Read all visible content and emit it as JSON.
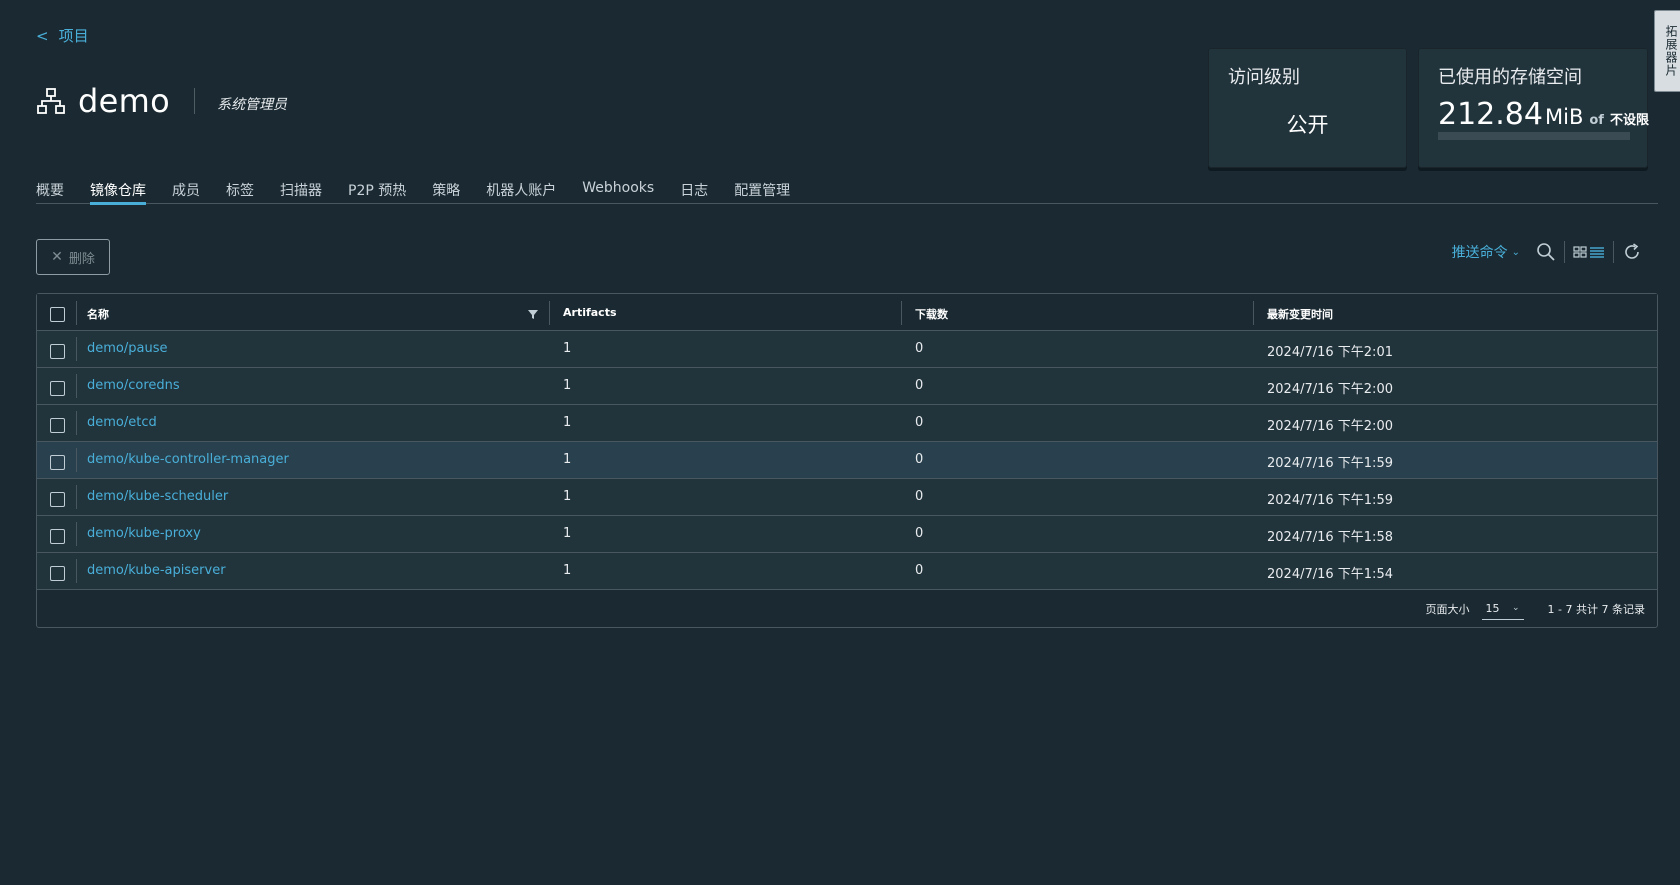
{
  "nav": {
    "back_label": "项目"
  },
  "project": {
    "name": "demo",
    "role": "系统管理员"
  },
  "cards": {
    "access": {
      "title": "访问级别",
      "value": "公开"
    },
    "storage": {
      "title": "已使用的存储空间",
      "used": "212.84",
      "unit": "MiB",
      "of": "of",
      "limit": "不设限",
      "usage_fraction": 0
    }
  },
  "side_tab": {
    "label": "拓展器片"
  },
  "tabs": [
    "概要",
    "镜像仓库",
    "成员",
    "标签",
    "扫描器",
    "P2P 预热",
    "策略",
    "机器人账户",
    "Webhooks",
    "日志",
    "配置管理"
  ],
  "active_tab": "镜像仓库",
  "toolbar": {
    "delete_label": "删除",
    "push_command_label": "推送命令"
  },
  "table": {
    "columns": [
      "名称",
      "Artifacts",
      "下载数",
      "最新变更时间"
    ],
    "rows": [
      {
        "name": "demo/pause",
        "artifacts": "1",
        "pulls": "0",
        "updated": "2024/7/16 下午2:01"
      },
      {
        "name": "demo/coredns",
        "artifacts": "1",
        "pulls": "0",
        "updated": "2024/7/16 下午2:00"
      },
      {
        "name": "demo/etcd",
        "artifacts": "1",
        "pulls": "0",
        "updated": "2024/7/16 下午2:00"
      },
      {
        "name": "demo/kube-controller-manager",
        "artifacts": "1",
        "pulls": "0",
        "updated": "2024/7/16 下午1:59"
      },
      {
        "name": "demo/kube-scheduler",
        "artifacts": "1",
        "pulls": "0",
        "updated": "2024/7/16 下午1:59"
      },
      {
        "name": "demo/kube-proxy",
        "artifacts": "1",
        "pulls": "0",
        "updated": "2024/7/16 下午1:58"
      },
      {
        "name": "demo/kube-apiserver",
        "artifacts": "1",
        "pulls": "0",
        "updated": "2024/7/16 下午1:54"
      }
    ],
    "footer": {
      "page_size_label": "页面大小",
      "page_size": "15",
      "summary": "1 - 7 共计 7 条记录"
    }
  },
  "colors": {
    "background": "#1b2a32",
    "accent": "#49afd9",
    "card": "#21333b"
  }
}
